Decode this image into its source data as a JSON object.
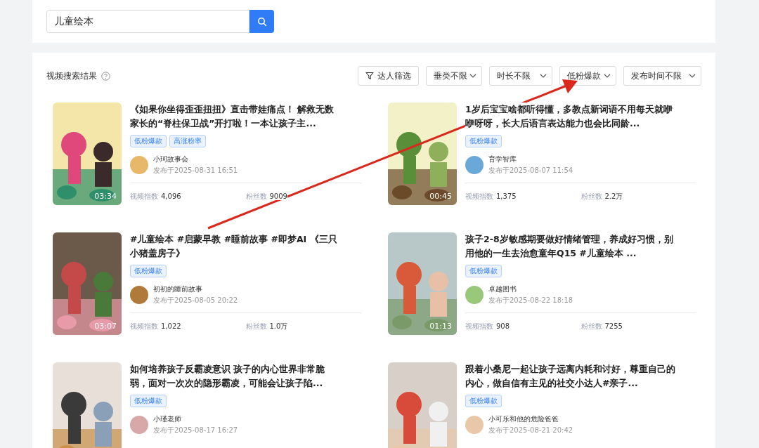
{
  "search": {
    "value": "儿童绘本"
  },
  "results": {
    "title": "视频搜索结果",
    "filter_button": "达人筛选",
    "selects": [
      {
        "value": "垂类不限"
      },
      {
        "value": "时长不限"
      },
      {
        "value": "低粉爆款"
      },
      {
        "value": "发布时间不限"
      }
    ],
    "videos": [
      {
        "title": "《如果你坐得歪歪扭扭》直击带娃痛点！ 解救无数家长的“脊柱保卫战”开打啦！一本让孩子主...",
        "duration": "03:34",
        "tags": [
          "低粉爆款",
          "高涨粉率"
        ],
        "author": "小珂故事会",
        "published": "发布于2025-08-31 16:51",
        "stats": [
          {
            "label": "视频指数",
            "value": "4,096"
          },
          {
            "label": "粉丝数",
            "value": "9009"
          }
        ]
      },
      {
        "title": "1岁后宝宝啥都听得懂，多教点新词语不用每天就咿咿呀呀，长大后语言表达能力也会比同龄...",
        "duration": "00:45",
        "tags": [
          "低粉爆款"
        ],
        "author": "育学智库",
        "published": "发布于2025-08-07 11:54",
        "stats": [
          {
            "label": "视频指数",
            "value": "1,375"
          },
          {
            "label": "粉丝数",
            "value": "2.2万"
          }
        ]
      },
      {
        "title": "#儿童绘本 #启蒙早教 #睡前故事 #即梦AI 《三只小猪盖房子》",
        "duration": "03:07",
        "tags": [
          "低粉爆款"
        ],
        "author": "初初的睡前故事",
        "published": "发布于2025-08-05 20:22",
        "stats": [
          {
            "label": "视频指数",
            "value": "1,022"
          },
          {
            "label": "粉丝数",
            "value": "1.0万"
          }
        ]
      },
      {
        "title": "孩子2-8岁敏感期要做好情绪管理，养成好习惯，别用他的一生去治愈童年Q15 #儿童绘本 ...",
        "duration": "01:13",
        "tags": [
          "低粉爆款"
        ],
        "author": "卓越图书",
        "published": "发布于2025-08-22 18:18",
        "stats": [
          {
            "label": "视频指数",
            "value": "908"
          },
          {
            "label": "粉丝数",
            "value": "7255"
          }
        ]
      },
      {
        "title": "如何培养孩子反霸凌意识 孩子的内心世界非常脆弱，面对一次次的隐形霸凌，可能会让孩子陷...",
        "tags": [
          "低粉爆款"
        ],
        "author": "小瑾老师",
        "published": "发布于2025-08-17 16:27"
      },
      {
        "title": "跟着小桑尼一起让孩子远离内耗和讨好，尊重自己的内心，做自信有主见的社交小达人#亲子...",
        "tags": [
          "低粉爆款"
        ],
        "author": "小可乐和他的危险爸爸",
        "published": "发布于2025-08-21 20:42"
      }
    ]
  }
}
